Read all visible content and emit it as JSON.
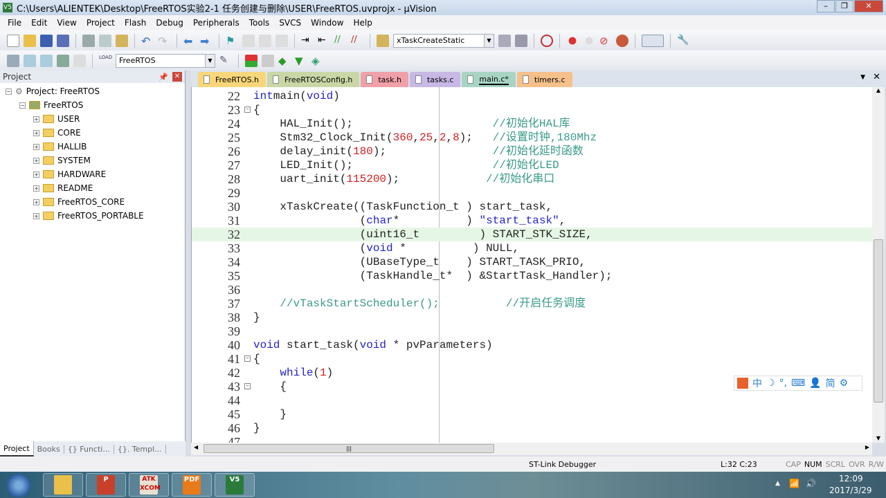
{
  "window": {
    "title": "C:\\Users\\ALIENTEK\\Desktop\\FreeRTOS实验2-1 任务创建与删除\\USER\\FreeRTOS.uvprojx - µVision",
    "app_icon": "V5"
  },
  "menu": [
    "File",
    "Edit",
    "View",
    "Project",
    "Flash",
    "Debug",
    "Peripherals",
    "Tools",
    "SVCS",
    "Window",
    "Help"
  ],
  "toolbar": {
    "find_combo": "xTaskCreateStatic",
    "target_combo": "FreeRTOS",
    "load_label": "LOAD"
  },
  "project_panel": {
    "title": "Project",
    "root": "Project: FreeRTOS",
    "target": "FreeRTOS",
    "groups": [
      "USER",
      "CORE",
      "HALLIB",
      "SYSTEM",
      "HARDWARE",
      "README",
      "FreeRTOS_CORE",
      "FreeRTOS_PORTABLE"
    ]
  },
  "bottom_tabs": [
    "Project",
    "Books",
    "{} Functi...",
    "{}. Templ..."
  ],
  "file_tabs": [
    {
      "label": "FreeRTOS.h",
      "color": "#f8d77a"
    },
    {
      "label": "FreeRTOSConfig.h",
      "color": "#c9d7a6"
    },
    {
      "label": "task.h",
      "color": "#f0a0a8"
    },
    {
      "label": "tasks.c",
      "color": "#c7b8e6"
    },
    {
      "label": "main.c*",
      "color": "#a8d4c4",
      "active": true
    },
    {
      "label": "timers.c",
      "color": "#f6c08a"
    }
  ],
  "editor": {
    "current_line": 32,
    "lines": [
      {
        "n": "22",
        "t": [
          [
            "kw",
            "int"
          ],
          [
            "",
            "main("
          ],
          [
            "kw",
            "void"
          ],
          [
            "",
            ")"
          ]
        ]
      },
      {
        "n": "23",
        "fold": "−",
        "t": [
          [
            "",
            "{"
          ]
        ]
      },
      {
        "n": "24",
        "t": [
          [
            "",
            "    HAL_Init();                     "
          ],
          [
            "cmt",
            "//初始化HAL库"
          ]
        ]
      },
      {
        "n": "25",
        "t": [
          [
            "",
            "    Stm32_Clock_Init("
          ],
          [
            "num",
            "360"
          ],
          [
            "",
            ","
          ],
          [
            "num",
            "25"
          ],
          [
            "",
            ","
          ],
          [
            "num",
            "2"
          ],
          [
            "",
            ","
          ],
          [
            "num",
            "8"
          ],
          [
            "",
            ");   "
          ],
          [
            "cmt",
            "//设置时钟,180Mhz"
          ]
        ]
      },
      {
        "n": "26",
        "t": [
          [
            "",
            "    delay_init("
          ],
          [
            "num",
            "180"
          ],
          [
            "",
            ");                "
          ],
          [
            "cmt",
            "//初始化延时函数"
          ]
        ]
      },
      {
        "n": "27",
        "t": [
          [
            "",
            "    LED_Init();                     "
          ],
          [
            "cmt",
            "//初始化LED"
          ]
        ]
      },
      {
        "n": "28",
        "t": [
          [
            "",
            "    uart_init("
          ],
          [
            "num",
            "115200"
          ],
          [
            "",
            ");             "
          ],
          [
            "cmt",
            "//初始化串口"
          ]
        ]
      },
      {
        "n": "29",
        "t": []
      },
      {
        "n": "30",
        "t": [
          [
            "",
            "    xTaskCreate((TaskFunction_t ) start_task,"
          ]
        ]
      },
      {
        "n": "31",
        "t": [
          [
            "",
            "                ("
          ],
          [
            "kw",
            "char"
          ],
          [
            "",
            "*          ) "
          ],
          [
            "str",
            "\"start_task\""
          ],
          [
            "",
            ","
          ]
        ]
      },
      {
        "n": "32",
        "t": [
          [
            "",
            "                (uint16_t         ) START_STK_SIZE,"
          ]
        ]
      },
      {
        "n": "33",
        "t": [
          [
            "",
            "                ("
          ],
          [
            "kw",
            "void"
          ],
          [
            "",
            " *          ) NULL,"
          ]
        ]
      },
      {
        "n": "34",
        "t": [
          [
            "",
            "                (UBaseType_t    ) START_TASK_PRIO,"
          ]
        ]
      },
      {
        "n": "35",
        "t": [
          [
            "",
            "                (TaskHandle_t*  ) &StartTask_Handler);"
          ]
        ]
      },
      {
        "n": "36",
        "t": []
      },
      {
        "n": "37",
        "t": [
          [
            "cmt",
            "    //vTaskStartScheduler();          //开启任务调度"
          ]
        ]
      },
      {
        "n": "38",
        "t": [
          [
            "",
            "}"
          ]
        ]
      },
      {
        "n": "39",
        "t": []
      },
      {
        "n": "40",
        "t": [
          [
            "kw",
            "void"
          ],
          [
            "",
            " start_task("
          ],
          [
            "kw",
            "void"
          ],
          [
            "",
            " * pvParameters)"
          ]
        ]
      },
      {
        "n": "41",
        "fold": "−",
        "t": [
          [
            "",
            "{"
          ]
        ]
      },
      {
        "n": "42",
        "t": [
          [
            "",
            "    "
          ],
          [
            "kw",
            "while"
          ],
          [
            "",
            "("
          ],
          [
            "num",
            "1"
          ],
          [
            "",
            ")"
          ]
        ]
      },
      {
        "n": "43",
        "fold": "−",
        "t": [
          [
            "",
            "    {"
          ]
        ]
      },
      {
        "n": "44",
        "t": []
      },
      {
        "n": "45",
        "t": [
          [
            "",
            "    }"
          ]
        ]
      },
      {
        "n": "46",
        "t": [
          [
            "",
            "}"
          ]
        ]
      },
      {
        "n": "47",
        "t": []
      }
    ]
  },
  "ime_toolbar": [
    "中",
    "☽",
    "°,",
    "⌨",
    "👤",
    "简",
    "⚙"
  ],
  "status": {
    "debugger": "ST-Link Debugger",
    "position": "L:32 C:23",
    "indicators": [
      "CAP",
      "NUM",
      "SCRL",
      "OVR",
      "R/W"
    ]
  },
  "taskbar": {
    "apps": [
      "Explorer",
      "PowerPoint",
      "ATK XCOM",
      "Foxit PDF",
      "µVision"
    ],
    "time": "12:09",
    "date": "2017/3/29"
  }
}
